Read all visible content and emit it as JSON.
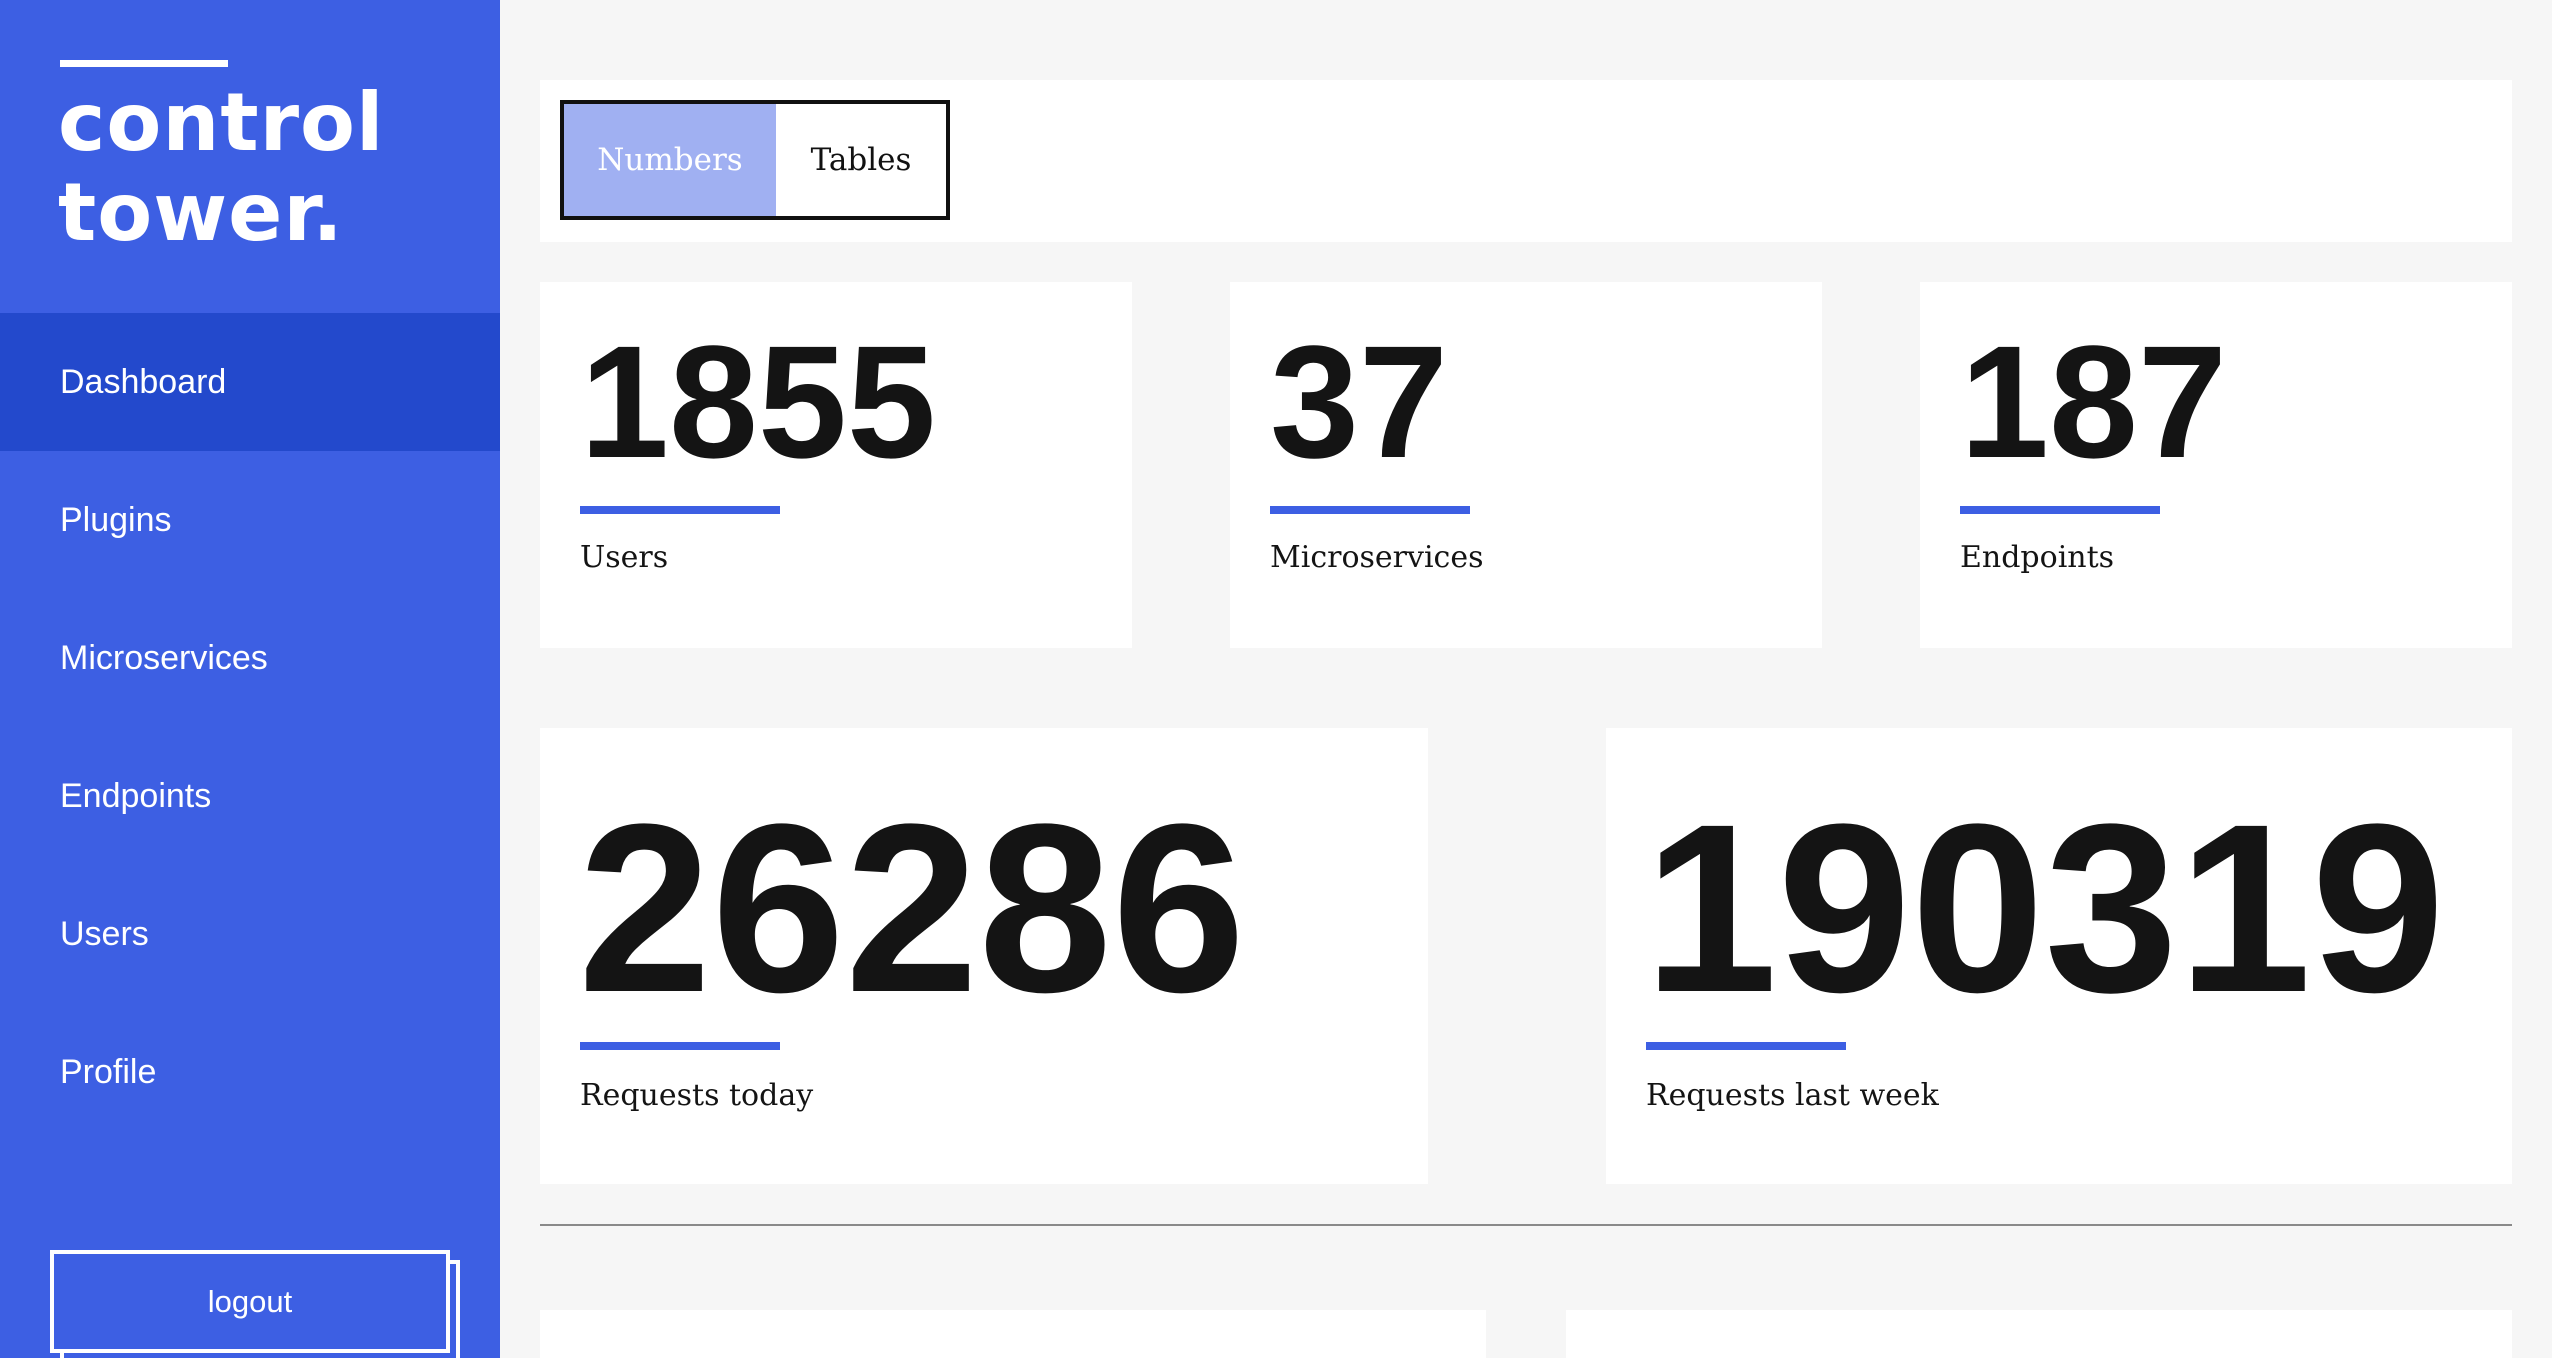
{
  "sidebar": {
    "brand": "control\ntower.",
    "items": [
      {
        "label": "Dashboard",
        "active": true
      },
      {
        "label": "Plugins",
        "active": false
      },
      {
        "label": "Microservices",
        "active": false
      },
      {
        "label": "Endpoints",
        "active": false
      },
      {
        "label": "Users",
        "active": false
      },
      {
        "label": "Profile",
        "active": false
      }
    ],
    "logout_label": "logout"
  },
  "view_toggle": {
    "options": [
      "Numbers",
      "Tables"
    ],
    "selected": "Numbers"
  },
  "stats": {
    "users": {
      "value": "1855",
      "label": "Users"
    },
    "microservices": {
      "value": "37",
      "label": "Microservices"
    },
    "endpoints": {
      "value": "187",
      "label": "Endpoints"
    },
    "requests_today": {
      "value": "26286",
      "label": "Requests today"
    },
    "requests_last_week": {
      "value": "190319",
      "label": "Requests last week"
    }
  },
  "colors": {
    "accent": "#3d5fe3",
    "sidebar_active": "#2349cc",
    "toggle_selected": "#a0b0f2",
    "background": "#f6f6f6"
  }
}
